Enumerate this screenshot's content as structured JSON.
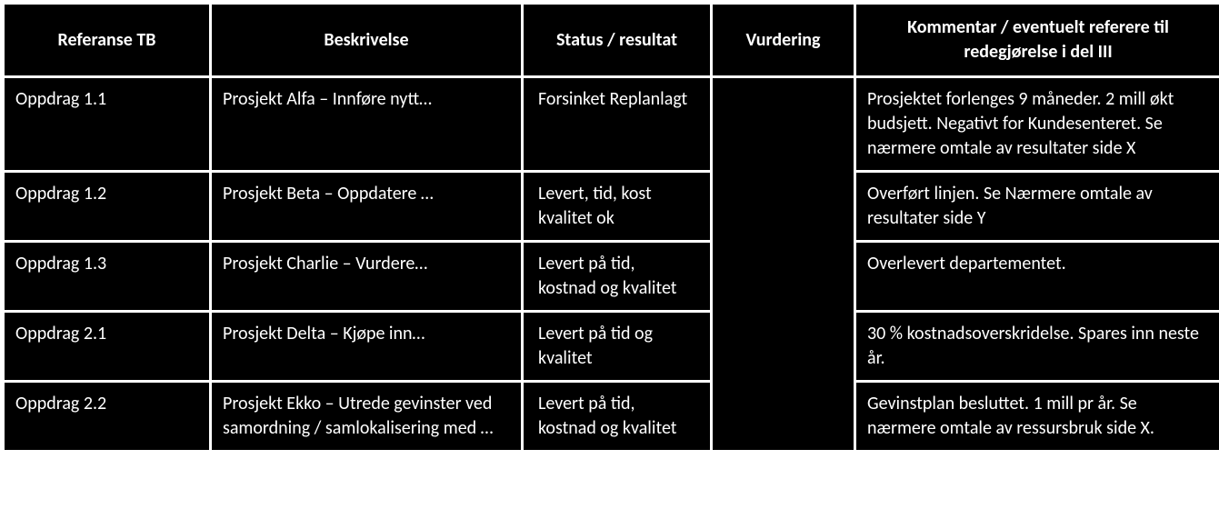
{
  "table": {
    "headers": {
      "referanse": "Referanse TB",
      "beskrivelse": "Beskrivelse",
      "status": "Status / resultat",
      "vurdering": "Vurdering",
      "kommentar": "Kommentar / eventuelt referere til redegjørelse i del III"
    },
    "rows": [
      {
        "referanse": "Oppdrag 1.1",
        "beskrivelse": "Prosjekt Alfa – Innføre nytt…",
        "status": "Forsinket Replanlagt",
        "vurdering": "",
        "kommentar": "Prosjektet forlenges 9 måneder. 2 mill økt budsjett. Negativt for Kundesenteret. Se nærmere omtale av resultater side X"
      },
      {
        "referanse": "Oppdrag 1.2",
        "beskrivelse": "Prosjekt Beta – Oppdatere …",
        "status": "Levert, tid, kost kvalitet ok",
        "vurdering": "",
        "kommentar": "Overført linjen. Se Nærmere omtale av resultater side Y"
      },
      {
        "referanse": "Oppdrag 1.3",
        "beskrivelse": "Prosjekt Charlie – Vurdere…",
        "status": "Levert på tid, kostnad og kvalitet",
        "vurdering": "",
        "kommentar": "Overlevert  departementet."
      },
      {
        "referanse": "Oppdrag 2.1",
        "beskrivelse": "Prosjekt Delta – Kjøpe inn…",
        "status": "Levert på tid og kvalitet",
        "vurdering": "",
        "kommentar": "30 % kostnadsoverskridelse. Spares inn neste år."
      },
      {
        "referanse": "Oppdrag 2.2",
        "beskrivelse": "Prosjekt Ekko – Utrede  gevinster ved samordning / samlokalisering med …",
        "status": "Levert på tid, kostnad og kvalitet",
        "vurdering": "",
        "kommentar": "Gevinstplan besluttet. 1 mill pr år. Se nærmere omtale av ressursbruk side X."
      }
    ]
  }
}
